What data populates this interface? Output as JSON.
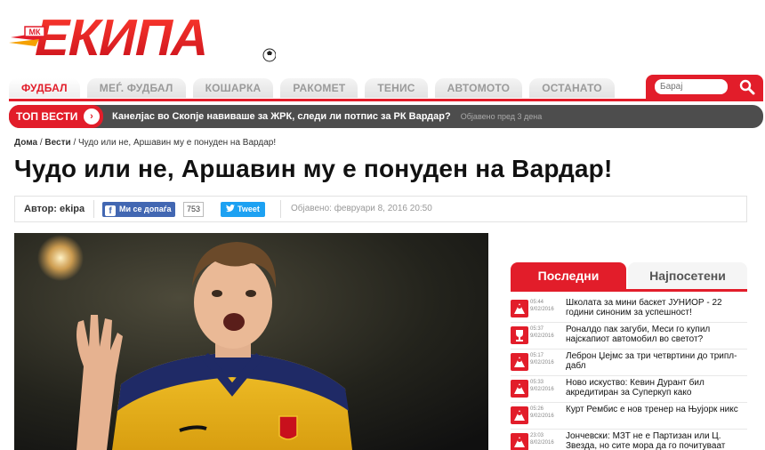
{
  "brand": {
    "logo_text": "ЕКИПА",
    "logo_badge": "МК",
    "accent": "#e21d2a"
  },
  "nav": {
    "tabs": [
      "ФУДБАЛ",
      "МЕЃ. ФУДБАЛ",
      "КОШАРКА",
      "РАКОМЕТ",
      "ТЕНИС",
      "АВТОМОТО",
      "ОСТАНАТО"
    ],
    "active": "ФУДБАЛ",
    "search_placeholder": "Барај"
  },
  "top_news": {
    "label": "ТОП ВЕСТИ",
    "headline": "Канелјас во Скопје навиваше за ЖРК, следи ли потпис за РК Вардар?",
    "time": "Објавено пред 3 дена"
  },
  "breadcrumb": {
    "home": "Дома",
    "section": "Вести",
    "current": "Чудо или не, Аршавин му е понуден на Вардар!",
    "sep": "/"
  },
  "article": {
    "title": "Чудо или не, Аршавин му е понуден на Вардар!",
    "author": "Автор: ekipa",
    "like_label": "Ми се допаѓа",
    "like_count": "753",
    "tweet_label": "Tweet",
    "published": "Објавено: февруари 8, 2016 20:50"
  },
  "sidebar": {
    "tabs": [
      "Последни",
      "Најпосетени"
    ],
    "active_tab": "Последни",
    "items": [
      {
        "time": "05:44",
        "date": "9/02/2016",
        "text": "Школата за мини баскет ЈУНИОР - 22 години синоним за успешност!",
        "icon": "basketball-icon"
      },
      {
        "time": "05:37",
        "date": "9/02/2016",
        "text": "Роналдо пак загуби, Меси го купил најскапиот автомобил во светот?",
        "icon": "trophy-icon"
      },
      {
        "time": "05:17",
        "date": "9/02/2016",
        "text": "Леброн Џејмс за три четвртини до трипл-дабл",
        "icon": "basketball-icon"
      },
      {
        "time": "05:33",
        "date": "9/02/2016",
        "text": "Ново искуство: Кевин Дурант бил акредитиран за Суперкуп како",
        "icon": "basketball-icon"
      },
      {
        "time": "05:26",
        "date": "9/02/2016",
        "text": "Курт Рембис е нов тренер на Њујорк никс",
        "icon": "basketball-icon"
      },
      {
        "time": "23:03",
        "date": "8/02/2016",
        "text": "Јончевски: МЗТ не е Партизан или Ц. Звезда, но сите мора да го почитуваат",
        "icon": "basketball-icon"
      }
    ]
  }
}
